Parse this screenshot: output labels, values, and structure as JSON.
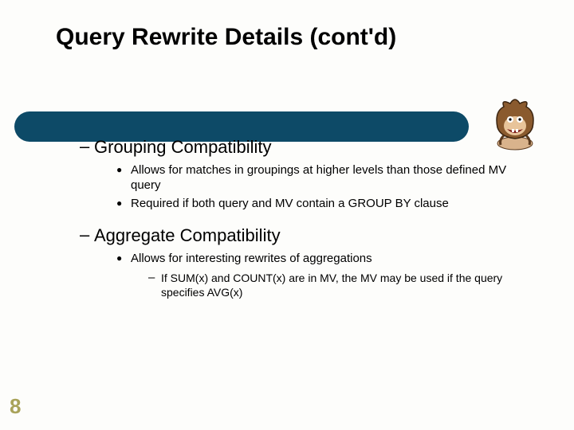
{
  "title": "Query Rewrite Details (cont'd)",
  "bullets": {
    "b1": {
      "heading": "Grouping Compatibility",
      "p1": "Allows for matches in groupings at higher levels than those defined MV query",
      "p2": "Required if both query and MV contain a GROUP BY clause"
    },
    "b2": {
      "heading": "Aggregate Compatibility",
      "p1": "Allows for interesting rewrites of aggregations",
      "s1": "If SUM(x) and COUNT(x) are in MV, the MV may be used if the query specifies AVG(x)"
    }
  },
  "page_number": "8"
}
